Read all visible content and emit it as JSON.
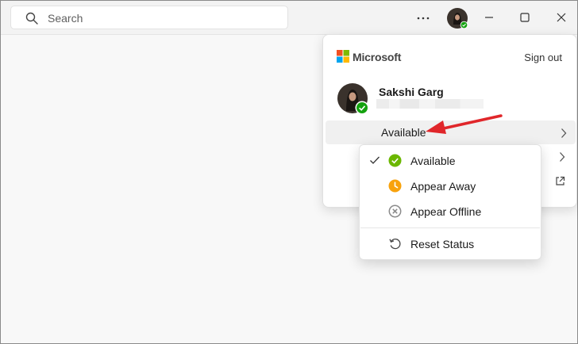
{
  "search": {
    "placeholder": "Search"
  },
  "flyout": {
    "brand": "Microsoft",
    "signout_label": "Sign out",
    "user_name": "Sakshi Garg",
    "status_label": "Available"
  },
  "status_menu": {
    "items": [
      {
        "label": "Available",
        "icon": "available-check-icon",
        "color": "#6bb700",
        "selected": true
      },
      {
        "label": "Appear Away",
        "icon": "away-clock-icon",
        "color": "#f8a20c",
        "selected": false
      },
      {
        "label": "Appear Offline",
        "icon": "offline-x-icon",
        "color": "#8a8a8a",
        "selected": false
      }
    ],
    "reset_label": "Reset Status"
  },
  "colors": {
    "available": "#6bb700",
    "away": "#f8a20c",
    "offline": "#8a8a8a",
    "annotation_arrow": "#e0262a",
    "presence_badge": "#13a10e"
  }
}
